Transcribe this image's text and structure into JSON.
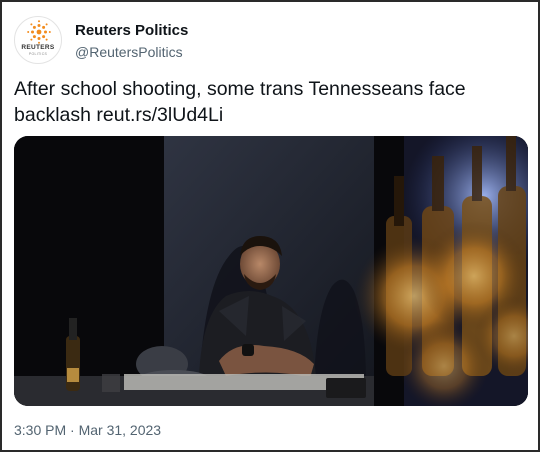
{
  "account": {
    "name": "Reuters Politics",
    "handle": "@ReutersPolitics",
    "avatar_brand": "REUTERS",
    "avatar_subtext": "POLITICS",
    "avatar_accent": "#f28c1e"
  },
  "tweet": {
    "text": "After school shooting, some trans Tennesseans face backlash reut.rs/3lUd4Li"
  },
  "meta": {
    "timestamp": "3:30 PM · Mar 31, 2023"
  },
  "colors": {
    "text_primary": "#0f1419",
    "text_secondary": "#536471",
    "border": "#2a2a2a"
  }
}
